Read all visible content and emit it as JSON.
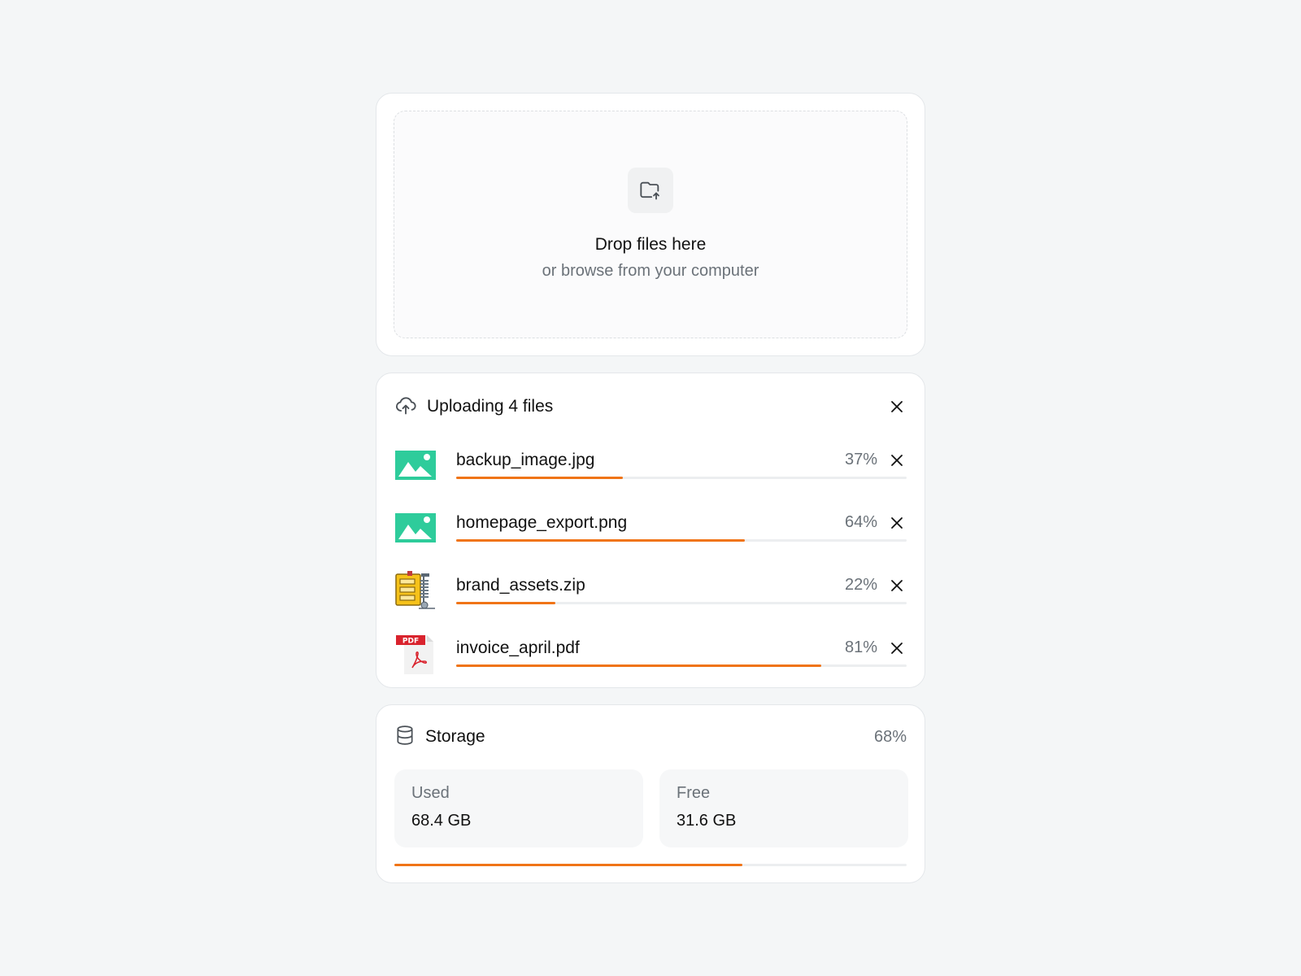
{
  "colors": {
    "accent": "#f07417",
    "track": "#eceef0",
    "image_icon": "#2ecc9b",
    "pdf_red": "#d9232d",
    "muted_text": "#6b7279"
  },
  "dropzone": {
    "icon": "folder-upload-icon",
    "title": "Drop files here",
    "subtitle": "or browse from your computer"
  },
  "uploads": {
    "icon": "cloud-upload-icon",
    "title": "Uploading 4 files",
    "close_icon": "close-icon",
    "files": [
      {
        "name": "backup_image.jpg",
        "percent_label": "37%",
        "progress": 37,
        "icon": "image-file-icon"
      },
      {
        "name": "homepage_export.png",
        "percent_label": "64%",
        "progress": 64,
        "icon": "image-file-icon"
      },
      {
        "name": "brand_assets.zip",
        "percent_label": "22%",
        "progress": 22,
        "icon": "zip-archive-icon"
      },
      {
        "name": "invoice_april.pdf",
        "percent_label": "81%",
        "progress": 81,
        "icon": "pdf-file-icon",
        "badge": "PDF"
      }
    ]
  },
  "storage": {
    "icon": "database-icon",
    "title": "Storage",
    "percent_label": "68%",
    "progress": 68,
    "used": {
      "label": "Used",
      "value": "68.4 GB"
    },
    "free": {
      "label": "Free",
      "value": "31.6 GB"
    }
  }
}
